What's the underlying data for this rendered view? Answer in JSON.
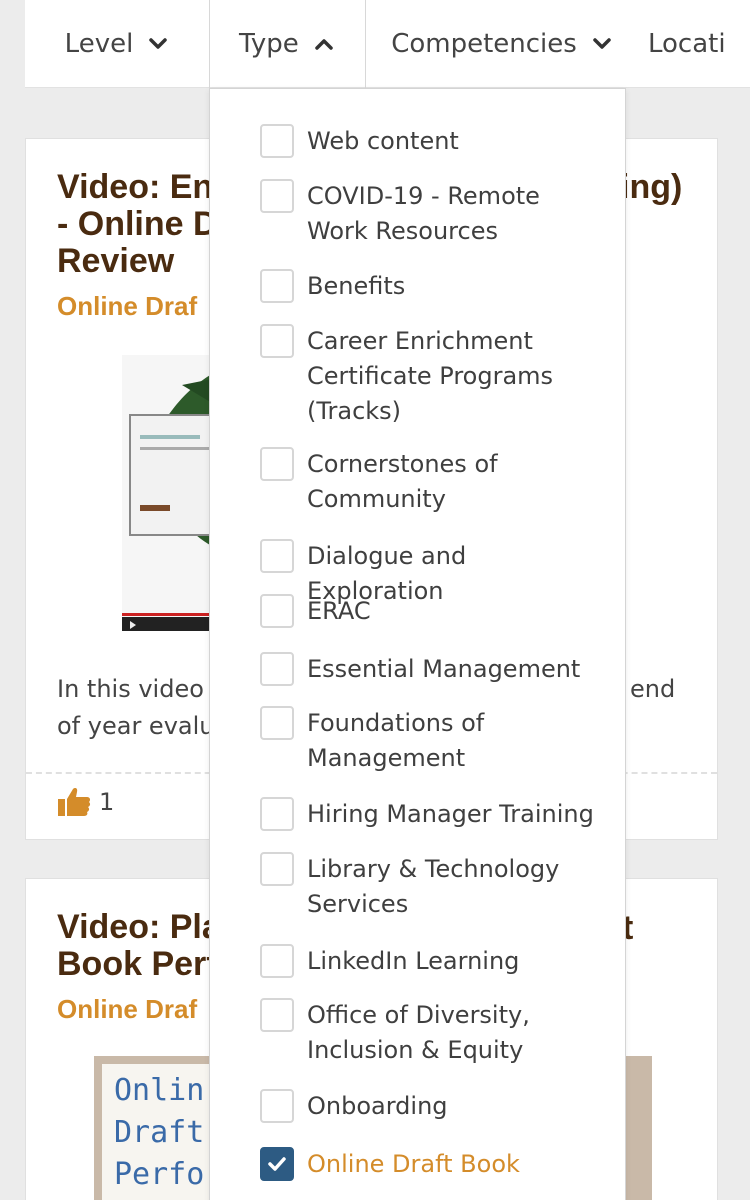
{
  "filters": {
    "level": "Level",
    "type": "Type",
    "competencies": "Competencies",
    "location": "Locati"
  },
  "cards": [
    {
      "title_left": "Video: En",
      "title_right": "ing)",
      "title_line2": "- Online D",
      "title_line3": "Review",
      "subtitle": "Online Draf",
      "desc_line1_left": "In this video",
      "desc_line1_right": "end",
      "desc_line2": "of year evalu",
      "likes": "1"
    },
    {
      "title_line1": "Video: Pla",
      "title_line2": "Book Perf",
      "subtitle": "Online Draf",
      "thumb_text": [
        "Onlin",
        "Draft",
        "Perfo"
      ]
    }
  ],
  "type_options": [
    {
      "label": "Web content",
      "checked": false
    },
    {
      "label": "COVID-19 - Remote Work Resources",
      "checked": false
    },
    {
      "label": "Benefits",
      "checked": false
    },
    {
      "label": "Career Enrichment Certificate Programs (Tracks)",
      "checked": false
    },
    {
      "label": "Cornerstones of Community",
      "checked": false
    },
    {
      "label": "Dialogue and Exploration",
      "checked": false
    },
    {
      "label": "ERAC",
      "checked": false
    },
    {
      "label": "Essential Management",
      "checked": false
    },
    {
      "label": "Foundations of Management",
      "checked": false
    },
    {
      "label": "Hiring Manager Training",
      "checked": false
    },
    {
      "label": "Library & Technology Services",
      "checked": false
    },
    {
      "label": "LinkedIn Learning",
      "checked": false
    },
    {
      "label": "Office of Diversity, Inclusion & Equity",
      "checked": false
    },
    {
      "label": "Onboarding",
      "checked": false
    },
    {
      "label": "Online Draft Book",
      "checked": true
    }
  ],
  "colors": {
    "title_brown": "#4a2b10",
    "accent_orange": "#d48c2a",
    "checkbox_blue": "#2d5b83"
  }
}
